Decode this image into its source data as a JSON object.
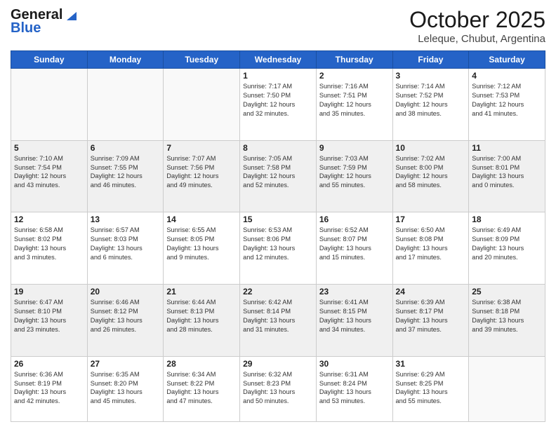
{
  "header": {
    "logo_line1": "General",
    "logo_line2": "Blue",
    "month": "October 2025",
    "location": "Leleque, Chubut, Argentina"
  },
  "days_of_week": [
    "Sunday",
    "Monday",
    "Tuesday",
    "Wednesday",
    "Thursday",
    "Friday",
    "Saturday"
  ],
  "weeks": [
    [
      {
        "day": "",
        "content": ""
      },
      {
        "day": "",
        "content": ""
      },
      {
        "day": "",
        "content": ""
      },
      {
        "day": "1",
        "content": "Sunrise: 7:17 AM\nSunset: 7:50 PM\nDaylight: 12 hours\nand 32 minutes."
      },
      {
        "day": "2",
        "content": "Sunrise: 7:16 AM\nSunset: 7:51 PM\nDaylight: 12 hours\nand 35 minutes."
      },
      {
        "day": "3",
        "content": "Sunrise: 7:14 AM\nSunset: 7:52 PM\nDaylight: 12 hours\nand 38 minutes."
      },
      {
        "day": "4",
        "content": "Sunrise: 7:12 AM\nSunset: 7:53 PM\nDaylight: 12 hours\nand 41 minutes."
      }
    ],
    [
      {
        "day": "5",
        "content": "Sunrise: 7:10 AM\nSunset: 7:54 PM\nDaylight: 12 hours\nand 43 minutes."
      },
      {
        "day": "6",
        "content": "Sunrise: 7:09 AM\nSunset: 7:55 PM\nDaylight: 12 hours\nand 46 minutes."
      },
      {
        "day": "7",
        "content": "Sunrise: 7:07 AM\nSunset: 7:56 PM\nDaylight: 12 hours\nand 49 minutes."
      },
      {
        "day": "8",
        "content": "Sunrise: 7:05 AM\nSunset: 7:58 PM\nDaylight: 12 hours\nand 52 minutes."
      },
      {
        "day": "9",
        "content": "Sunrise: 7:03 AM\nSunset: 7:59 PM\nDaylight: 12 hours\nand 55 minutes."
      },
      {
        "day": "10",
        "content": "Sunrise: 7:02 AM\nSunset: 8:00 PM\nDaylight: 12 hours\nand 58 minutes."
      },
      {
        "day": "11",
        "content": "Sunrise: 7:00 AM\nSunset: 8:01 PM\nDaylight: 13 hours\nand 0 minutes."
      }
    ],
    [
      {
        "day": "12",
        "content": "Sunrise: 6:58 AM\nSunset: 8:02 PM\nDaylight: 13 hours\nand 3 minutes."
      },
      {
        "day": "13",
        "content": "Sunrise: 6:57 AM\nSunset: 8:03 PM\nDaylight: 13 hours\nand 6 minutes."
      },
      {
        "day": "14",
        "content": "Sunrise: 6:55 AM\nSunset: 8:05 PM\nDaylight: 13 hours\nand 9 minutes."
      },
      {
        "day": "15",
        "content": "Sunrise: 6:53 AM\nSunset: 8:06 PM\nDaylight: 13 hours\nand 12 minutes."
      },
      {
        "day": "16",
        "content": "Sunrise: 6:52 AM\nSunset: 8:07 PM\nDaylight: 13 hours\nand 15 minutes."
      },
      {
        "day": "17",
        "content": "Sunrise: 6:50 AM\nSunset: 8:08 PM\nDaylight: 13 hours\nand 17 minutes."
      },
      {
        "day": "18",
        "content": "Sunrise: 6:49 AM\nSunset: 8:09 PM\nDaylight: 13 hours\nand 20 minutes."
      }
    ],
    [
      {
        "day": "19",
        "content": "Sunrise: 6:47 AM\nSunset: 8:10 PM\nDaylight: 13 hours\nand 23 minutes."
      },
      {
        "day": "20",
        "content": "Sunrise: 6:46 AM\nSunset: 8:12 PM\nDaylight: 13 hours\nand 26 minutes."
      },
      {
        "day": "21",
        "content": "Sunrise: 6:44 AM\nSunset: 8:13 PM\nDaylight: 13 hours\nand 28 minutes."
      },
      {
        "day": "22",
        "content": "Sunrise: 6:42 AM\nSunset: 8:14 PM\nDaylight: 13 hours\nand 31 minutes."
      },
      {
        "day": "23",
        "content": "Sunrise: 6:41 AM\nSunset: 8:15 PM\nDaylight: 13 hours\nand 34 minutes."
      },
      {
        "day": "24",
        "content": "Sunrise: 6:39 AM\nSunset: 8:17 PM\nDaylight: 13 hours\nand 37 minutes."
      },
      {
        "day": "25",
        "content": "Sunrise: 6:38 AM\nSunset: 8:18 PM\nDaylight: 13 hours\nand 39 minutes."
      }
    ],
    [
      {
        "day": "26",
        "content": "Sunrise: 6:36 AM\nSunset: 8:19 PM\nDaylight: 13 hours\nand 42 minutes."
      },
      {
        "day": "27",
        "content": "Sunrise: 6:35 AM\nSunset: 8:20 PM\nDaylight: 13 hours\nand 45 minutes."
      },
      {
        "day": "28",
        "content": "Sunrise: 6:34 AM\nSunset: 8:22 PM\nDaylight: 13 hours\nand 47 minutes."
      },
      {
        "day": "29",
        "content": "Sunrise: 6:32 AM\nSunset: 8:23 PM\nDaylight: 13 hours\nand 50 minutes."
      },
      {
        "day": "30",
        "content": "Sunrise: 6:31 AM\nSunset: 8:24 PM\nDaylight: 13 hours\nand 53 minutes."
      },
      {
        "day": "31",
        "content": "Sunrise: 6:29 AM\nSunset: 8:25 PM\nDaylight: 13 hours\nand 55 minutes."
      },
      {
        "day": "",
        "content": ""
      }
    ]
  ]
}
